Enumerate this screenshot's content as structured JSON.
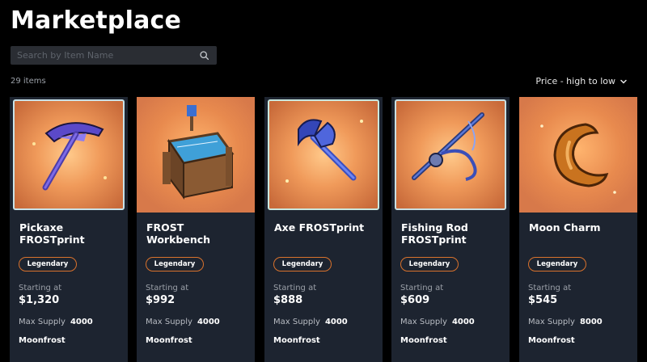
{
  "page": {
    "title": "Marketplace",
    "search_placeholder": "Search by Item Name",
    "item_count": "29 items",
    "sort_label": "Price - high to low"
  },
  "cards": [
    {
      "name": "Pickaxe FROSTprint",
      "rarity": "Legendary",
      "starting_label": "Starting at",
      "price": "$1,320",
      "supply_label": "Max Supply",
      "supply": "4000",
      "creator": "Moonfrost",
      "icon": "pickaxe-icon"
    },
    {
      "name": "FROST Workbench",
      "rarity": "Legendary",
      "starting_label": "Starting at",
      "price": "$992",
      "supply_label": "Max Supply",
      "supply": "4000",
      "creator": "Moonfrost",
      "icon": "workbench-icon"
    },
    {
      "name": "Axe FROSTprint",
      "rarity": "Legendary",
      "starting_label": "Starting at",
      "price": "$888",
      "supply_label": "Max Supply",
      "supply": "4000",
      "creator": "Moonfrost",
      "icon": "axe-icon"
    },
    {
      "name": "Fishing Rod FROSTprint",
      "rarity": "Legendary",
      "starting_label": "Starting at",
      "price": "$609",
      "supply_label": "Max Supply",
      "supply": "4000",
      "creator": "Moonfrost",
      "icon": "fishing-rod-icon"
    },
    {
      "name": "Moon Charm",
      "rarity": "Legendary",
      "starting_label": "Starting at",
      "price": "$545",
      "supply_label": "Max Supply",
      "supply": "8000",
      "creator": "Moonfrost",
      "icon": "moon-charm-icon"
    }
  ],
  "colors": {
    "background": "#000000",
    "card": "#1d2430",
    "badge_border": "#d9722c",
    "art_orange": "#e88a4e"
  }
}
